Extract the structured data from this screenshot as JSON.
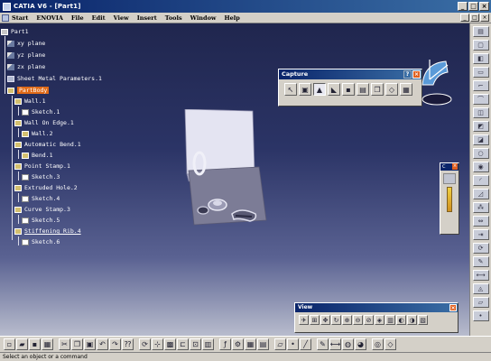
{
  "window": {
    "title": "CATIA V6 - [Part1]",
    "controls": [
      "_",
      "□",
      "×"
    ]
  },
  "menu": {
    "items": [
      "Start",
      "ENOVIA",
      "File",
      "Edit",
      "View",
      "Insert",
      "Tools",
      "Window",
      "Help"
    ],
    "controls": [
      "_",
      "□",
      "×"
    ]
  },
  "tree": {
    "root": "Part1",
    "nodes": [
      {
        "label": "xy plane",
        "icon": "plane-icon"
      },
      {
        "label": "yz plane",
        "icon": "plane-icon"
      },
      {
        "label": "zx plane",
        "icon": "plane-icon"
      },
      {
        "label": "Sheet Metal Parameters.1",
        "icon": "sheet-metal-parameters-icon"
      },
      {
        "label": "PartBody",
        "icon": "part-body-icon",
        "selected": true
      },
      {
        "label": "Wall.1",
        "icon": "wall-icon"
      },
      {
        "label": "Sketch.1",
        "icon": "sketch-icon"
      },
      {
        "label": "Wall On Edge.1",
        "icon": "wall-on-edge-icon"
      },
      {
        "label": "Wall.2",
        "icon": "wall-icon"
      },
      {
        "label": "Automatic Bend.1",
        "icon": "automatic-bend-icon"
      },
      {
        "label": "Bend.1",
        "icon": "bend-icon"
      },
      {
        "label": "Point Stamp.1",
        "icon": "point-stamp-icon"
      },
      {
        "label": "Sketch.3",
        "icon": "sketch-icon"
      },
      {
        "label": "Extruded Hole.2",
        "icon": "extruded-hole-icon"
      },
      {
        "label": "Sketch.4",
        "icon": "sketch-icon"
      },
      {
        "label": "Curve Stamp.3",
        "icon": "curve-stamp-icon"
      },
      {
        "label": "Sketch.5",
        "icon": "sketch-icon"
      },
      {
        "label": "Stiffening Rib.4",
        "icon": "stiffening-rib-icon",
        "underlined": true
      },
      {
        "label": "Sketch.6",
        "icon": "sketch-icon"
      }
    ]
  },
  "capture_toolbar": {
    "title": "Capture",
    "help": "?",
    "close": "×",
    "tools": [
      "select-icon",
      "capture-icon",
      "picture-icon",
      "chart-capture-icon",
      "save-icon",
      "album-icon",
      "copy-icon",
      "options-icon",
      "print-icon"
    ]
  },
  "mini_toolbar": {
    "title": "C",
    "close": "×"
  },
  "view_toolbar": {
    "title": "View",
    "close": "×",
    "tools": [
      "fly-icon",
      "fit-all-icon",
      "pan-icon",
      "rotate-icon",
      "zoom-in-icon",
      "zoom-out-icon",
      "normal-view-icon",
      "quick-view-icon",
      "view-mode-icon",
      "hide-show-icon",
      "swap-visible-icon",
      "render-style-icon"
    ]
  },
  "status": {
    "text": "Select an object or a command"
  },
  "colors": {
    "title_bar": "#0a246a",
    "selected_node": "#e06a18",
    "viewport_top": "#20264e",
    "viewport_bottom": "#b8bccd"
  }
}
